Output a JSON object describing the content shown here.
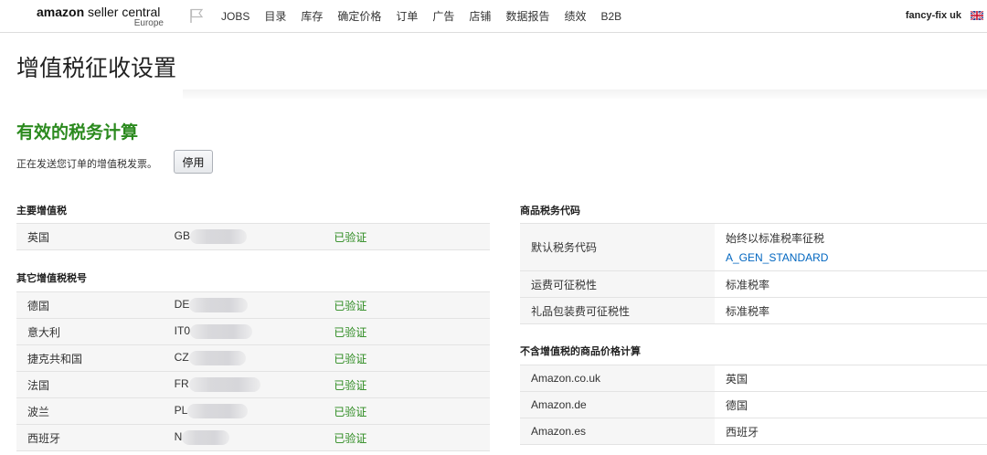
{
  "header": {
    "logo_brand": "amazon",
    "logo_text": "seller central",
    "logo_region": "Europe",
    "nav": [
      "JOBS",
      "目录",
      "库存",
      "确定价格",
      "订单",
      "广告",
      "店铺",
      "数据报告",
      "绩效",
      "B2B"
    ],
    "account": "fancy-fix uk"
  },
  "page": {
    "title": "增值税征收设置",
    "section_title": "有效的税务计算",
    "send_text": "正在发送您订单的增值税发票。",
    "disable_button": "停用"
  },
  "primary_vat": {
    "heading": "主要增值税",
    "rows": [
      {
        "country": "英国",
        "number": "GB",
        "status": "已验证"
      }
    ]
  },
  "other_vat": {
    "heading": "其它增值税税号",
    "rows": [
      {
        "country": "德国",
        "number": "DE",
        "status": "已验证"
      },
      {
        "country": "意大利",
        "number": "IT0",
        "status": "已验证"
      },
      {
        "country": "捷克共和国",
        "number": "CZ",
        "status": "已验证"
      },
      {
        "country": "法国",
        "number": "FR",
        "status": "已验证"
      },
      {
        "country": "波兰",
        "number": "PL",
        "status": "已验证"
      },
      {
        "country": "西班牙",
        "number": "N",
        "status": "已验证"
      }
    ]
  },
  "tax_codes": {
    "heading": "商品税务代码",
    "rows": [
      {
        "label": "默认税务代码",
        "value": "始终以标准税率征税",
        "link": "A_GEN_STANDARD"
      },
      {
        "label": "运费可征税性",
        "value": "标准税率"
      },
      {
        "label": "礼品包装费可征税性",
        "value": "标准税率"
      }
    ]
  },
  "price_calc": {
    "heading": "不含增值税的商品价格计算",
    "rows": [
      {
        "site": "Amazon.co.uk",
        "country": "英国"
      },
      {
        "site": "Amazon.de",
        "country": "德国"
      },
      {
        "site": "Amazon.es",
        "country": "西班牙"
      }
    ]
  },
  "colors": {
    "verified": "#2b8a1e",
    "link": "#0066c0",
    "row_bg": "#f6f6f6"
  }
}
